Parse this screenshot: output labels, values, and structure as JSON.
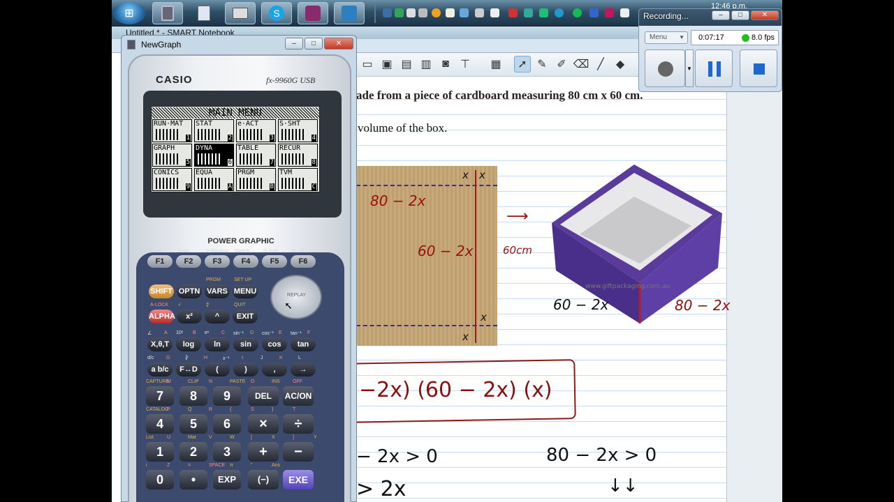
{
  "taskbar": {
    "clock": "12:46 p.m."
  },
  "notebook": {
    "title": "Untitled * - SMART Notebook",
    "text_line1": "ade from a piece of cardboard measuring 80 cm x 60 cm.",
    "text_line2": "volume of the box."
  },
  "annotations": {
    "top_label": "80 − 2x",
    "side_label": "60 − 2x",
    "x_top": "x",
    "x_top2": "x",
    "x_bottom": "x",
    "x_bottom2": "x",
    "measure": "60cm",
    "box_left": "60 − 2x",
    "box_right": "80 − 2x",
    "watermark": "www.giftpackaging.com.au",
    "volume_expr": "−2x) (60 − 2x) (x)",
    "ineq1": "− 2x > 0",
    "ineq2": "80 − 2x > 0",
    "ineq3": "> 2x",
    "ineq4": "↓↓"
  },
  "calculator_window": {
    "title": "NewGraph",
    "brand": "CASIO",
    "model": "fx-9960G USB",
    "screen_title": "MAIN MENU",
    "power_graphic": "POWER GRAPHIC",
    "menu_items": [
      {
        "label": "RUN·MAT",
        "key": "1"
      },
      {
        "label": "STAT",
        "key": "2"
      },
      {
        "label": "e·ACT",
        "key": "3"
      },
      {
        "label": "S·SHT",
        "key": "4"
      },
      {
        "label": "GRAPH",
        "key": "5"
      },
      {
        "label": "DYNA",
        "key": "6"
      },
      {
        "label": "TABLE",
        "key": "7"
      },
      {
        "label": "RECUR",
        "key": "8"
      },
      {
        "label": "CONICS",
        "key": "9"
      },
      {
        "label": "EQUA",
        "key": "A"
      },
      {
        "label": "PRGM",
        "key": "B"
      },
      {
        "label": "TVM",
        "key": "C"
      }
    ],
    "fkey_labels": [
      "Trace",
      "Zoom",
      "V-Window",
      "Sketch",
      "G-Solv",
      "G↔T"
    ],
    "fkeys": [
      "F1",
      "F2",
      "F3",
      "F4",
      "F5",
      "F6"
    ],
    "row1": [
      "SHIFT",
      "OPTN",
      "VARS",
      "MENU"
    ],
    "row1_sub": [
      "PRGM",
      "SET UP"
    ],
    "row2": [
      "ALPHA",
      "x²",
      "^",
      "EXIT"
    ],
    "row2_sub": [
      "A-LOCK",
      "√",
      "∜",
      "QUIT"
    ],
    "replay": "REPLAY",
    "row3": [
      "X,θ,T",
      "log",
      "ln",
      "sin",
      "cos",
      "tan"
    ],
    "row3_sub": [
      "∠",
      "A",
      "10ˣ",
      "B",
      "eˣ",
      "C",
      "sin⁻¹",
      "D",
      "cos⁻¹",
      "E",
      "tan⁻¹",
      "F"
    ],
    "row4": [
      "a b/c",
      "F↔D",
      "(",
      ")",
      ",",
      "→"
    ],
    "row4_sub": [
      "d/c",
      "G",
      "∛",
      "H",
      "x⁻¹",
      "I",
      "J",
      "K",
      "L"
    ],
    "digits_row1": [
      "7",
      "8",
      "9",
      "DEL",
      "AC/ON"
    ],
    "digits_row1_sub": [
      "CAPTURE",
      "M",
      "CLIP",
      "N",
      "PASTE",
      "O",
      "INS",
      "OFF"
    ],
    "digits_row2": [
      "4",
      "5",
      "6",
      "×",
      "÷"
    ],
    "digits_row2_sub": [
      "CATALOG",
      "P",
      "Q",
      "R",
      "{",
      "S",
      "}",
      "T"
    ],
    "digits_row3": [
      "1",
      "2",
      "3",
      "+",
      "−"
    ],
    "digits_row3_sub": [
      "List",
      "U",
      "Mat",
      "V",
      "W",
      "[",
      "X",
      "]",
      "Y"
    ],
    "digits_row4": [
      "0",
      "•",
      "EXP",
      "(−)",
      "EXE"
    ],
    "digits_row4_sub": [
      "i",
      "Z",
      "=",
      "SPACE",
      "π",
      "\"",
      "Ans"
    ]
  },
  "recording": {
    "title": "Recording...",
    "menu": "Menu",
    "elapsed": "0:07:17",
    "fps": "8.0 fps"
  }
}
